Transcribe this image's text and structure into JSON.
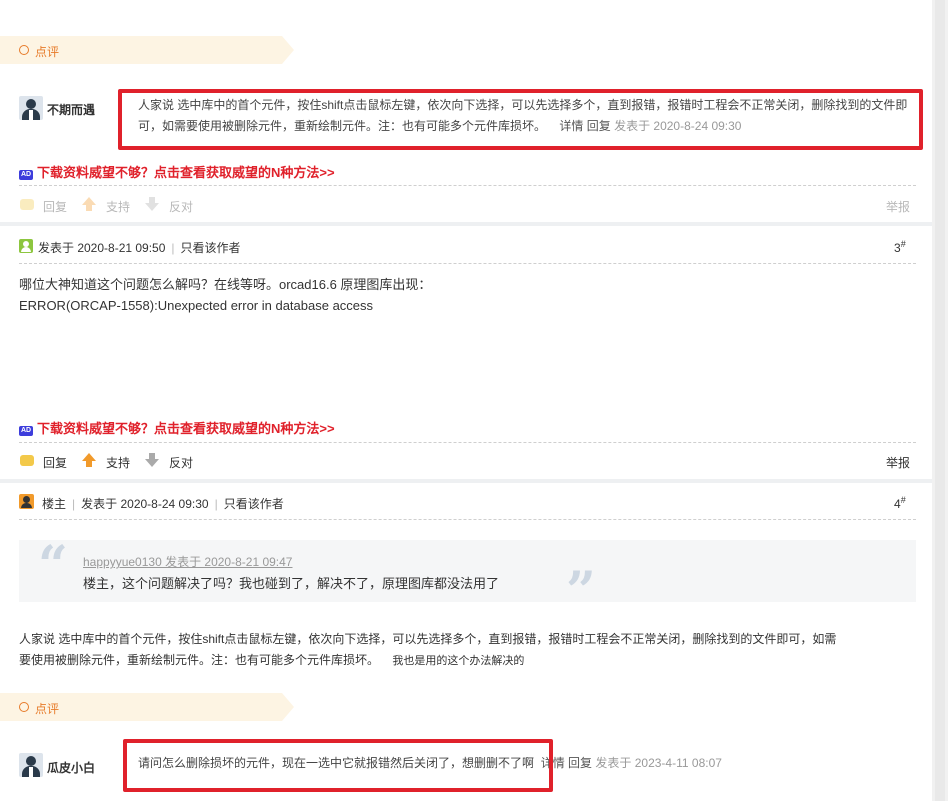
{
  "dianping_label": "点评",
  "comment1": {
    "user": "不期而遇",
    "line1": "人家说 选中库中的首个元件，按住shift点击鼠标左键，依次向下选择，可以先选择多个，直到报错，报错时工程会不正常关闭，删除找到的文件即",
    "line2": "可，如需要使用被删除元件，重新绘制元件。注：也有可能多个元件库损坏。",
    "detail": "详情",
    "reply": "回复",
    "meta": "发表于 2020-8-24 09:30"
  },
  "ad_text": "下载资料威望不够？点击查看获取威望的N种方法>>",
  "ad_icon": "AD",
  "actions": {
    "reply": "回复",
    "support": "支持",
    "oppose": "反对",
    "report": "举报"
  },
  "post3": {
    "posted": "发表于 2020-8-21 09:50",
    "only_author": "只看该作者",
    "floor": "3",
    "floor_mark": "#",
    "line1": "哪位大神知道这个问题怎么解吗？在线等呀。orcad16.6 原理图库出现：",
    "line2": "ERROR(ORCAP-1558):Unexpected error in database access"
  },
  "post4": {
    "role": "楼主",
    "posted": "发表于 2020-8-24 09:30",
    "only_author": "只看该作者",
    "floor": "4",
    "floor_mark": "#",
    "quote_meta": "happyyue0130 发表于 2020-8-21 09:47",
    "quote_text": "楼主，这个问题解决了吗？我也碰到了，解决不了，原理图库都没法用了",
    "body_line1": "人家说  选中库中的首个元件，按住shift点击鼠标左键，依次向下选择，可以先选择多个，直到报错，报错时工程会不正常关闭，删除找到的文件即可，如需",
    "body_line2": "要使用被删除元件，重新绘制元件。注：也有可能多个元件库损坏。",
    "body_tail": "我也是用的这个办法解决的"
  },
  "comment2": {
    "user": "瓜皮小白",
    "text": "请问怎么删除损坏的元件，现在一选中它就报错然后关闭了，想删删不了啊",
    "detail": "详情",
    "reply": "回复",
    "meta": "发表于 2023-4-11 08:07"
  },
  "colors": {
    "accent_orange": "#e77b2a",
    "highlight_red": "#e0212b",
    "ad_red": "#e0212b"
  }
}
